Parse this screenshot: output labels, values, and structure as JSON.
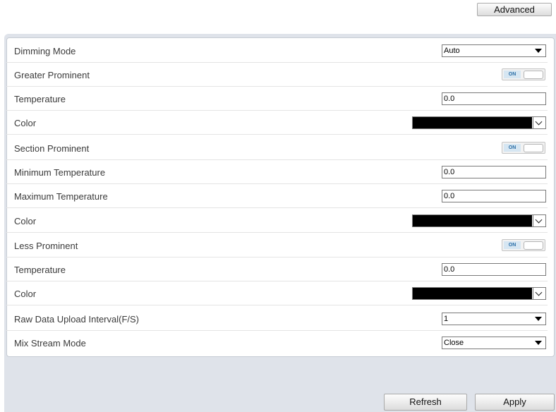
{
  "toolbar": {
    "advanced_label": "Advanced"
  },
  "rows": {
    "dimming_mode": {
      "label": "Dimming Mode",
      "value": "Auto"
    },
    "greater_prominent": {
      "label": "Greater Prominent",
      "toggle": "ON"
    },
    "greater_temperature": {
      "label": "Temperature",
      "value": "0.0"
    },
    "greater_color": {
      "label": "Color",
      "color": "#000000"
    },
    "section_prominent": {
      "label": "Section Prominent",
      "toggle": "ON"
    },
    "minimum_temperature": {
      "label": "Minimum Temperature",
      "value": "0.0"
    },
    "maximum_temperature": {
      "label": "Maximum Temperature",
      "value": "0.0"
    },
    "section_color": {
      "label": "Color",
      "color": "#000000"
    },
    "less_prominent": {
      "label": "Less Prominent",
      "toggle": "ON"
    },
    "less_temperature": {
      "label": "Temperature",
      "value": "0.0"
    },
    "less_color": {
      "label": "Color",
      "color": "#000000"
    },
    "raw_data_interval": {
      "label": "Raw Data Upload Interval(F/S)",
      "value": "1"
    },
    "mix_stream_mode": {
      "label": "Mix Stream Mode",
      "value": "Close"
    }
  },
  "footer": {
    "refresh_label": "Refresh",
    "apply_label": "Apply"
  },
  "colors": {
    "panel_background": "#dfe3ea",
    "toggle_accent": "#2a6ea6"
  }
}
